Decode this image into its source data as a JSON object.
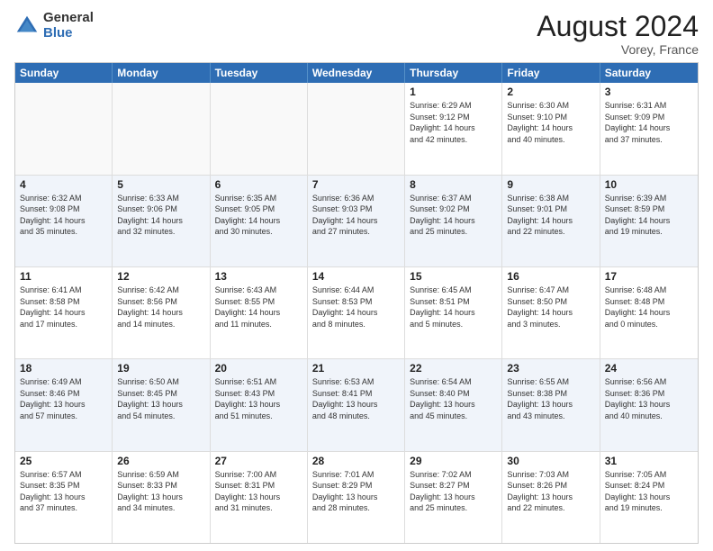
{
  "logo": {
    "general": "General",
    "blue": "Blue"
  },
  "header": {
    "month": "August 2024",
    "location": "Vorey, France"
  },
  "weekdays": [
    "Sunday",
    "Monday",
    "Tuesday",
    "Wednesday",
    "Thursday",
    "Friday",
    "Saturday"
  ],
  "rows": [
    [
      {
        "day": "",
        "info": "",
        "empty": true
      },
      {
        "day": "",
        "info": "",
        "empty": true
      },
      {
        "day": "",
        "info": "",
        "empty": true
      },
      {
        "day": "",
        "info": "",
        "empty": true
      },
      {
        "day": "1",
        "info": "Sunrise: 6:29 AM\nSunset: 9:12 PM\nDaylight: 14 hours\nand 42 minutes."
      },
      {
        "day": "2",
        "info": "Sunrise: 6:30 AM\nSunset: 9:10 PM\nDaylight: 14 hours\nand 40 minutes."
      },
      {
        "day": "3",
        "info": "Sunrise: 6:31 AM\nSunset: 9:09 PM\nDaylight: 14 hours\nand 37 minutes."
      }
    ],
    [
      {
        "day": "4",
        "info": "Sunrise: 6:32 AM\nSunset: 9:08 PM\nDaylight: 14 hours\nand 35 minutes."
      },
      {
        "day": "5",
        "info": "Sunrise: 6:33 AM\nSunset: 9:06 PM\nDaylight: 14 hours\nand 32 minutes."
      },
      {
        "day": "6",
        "info": "Sunrise: 6:35 AM\nSunset: 9:05 PM\nDaylight: 14 hours\nand 30 minutes."
      },
      {
        "day": "7",
        "info": "Sunrise: 6:36 AM\nSunset: 9:03 PM\nDaylight: 14 hours\nand 27 minutes."
      },
      {
        "day": "8",
        "info": "Sunrise: 6:37 AM\nSunset: 9:02 PM\nDaylight: 14 hours\nand 25 minutes."
      },
      {
        "day": "9",
        "info": "Sunrise: 6:38 AM\nSunset: 9:01 PM\nDaylight: 14 hours\nand 22 minutes."
      },
      {
        "day": "10",
        "info": "Sunrise: 6:39 AM\nSunset: 8:59 PM\nDaylight: 14 hours\nand 19 minutes."
      }
    ],
    [
      {
        "day": "11",
        "info": "Sunrise: 6:41 AM\nSunset: 8:58 PM\nDaylight: 14 hours\nand 17 minutes."
      },
      {
        "day": "12",
        "info": "Sunrise: 6:42 AM\nSunset: 8:56 PM\nDaylight: 14 hours\nand 14 minutes."
      },
      {
        "day": "13",
        "info": "Sunrise: 6:43 AM\nSunset: 8:55 PM\nDaylight: 14 hours\nand 11 minutes."
      },
      {
        "day": "14",
        "info": "Sunrise: 6:44 AM\nSunset: 8:53 PM\nDaylight: 14 hours\nand 8 minutes."
      },
      {
        "day": "15",
        "info": "Sunrise: 6:45 AM\nSunset: 8:51 PM\nDaylight: 14 hours\nand 5 minutes."
      },
      {
        "day": "16",
        "info": "Sunrise: 6:47 AM\nSunset: 8:50 PM\nDaylight: 14 hours\nand 3 minutes."
      },
      {
        "day": "17",
        "info": "Sunrise: 6:48 AM\nSunset: 8:48 PM\nDaylight: 14 hours\nand 0 minutes."
      }
    ],
    [
      {
        "day": "18",
        "info": "Sunrise: 6:49 AM\nSunset: 8:46 PM\nDaylight: 13 hours\nand 57 minutes."
      },
      {
        "day": "19",
        "info": "Sunrise: 6:50 AM\nSunset: 8:45 PM\nDaylight: 13 hours\nand 54 minutes."
      },
      {
        "day": "20",
        "info": "Sunrise: 6:51 AM\nSunset: 8:43 PM\nDaylight: 13 hours\nand 51 minutes."
      },
      {
        "day": "21",
        "info": "Sunrise: 6:53 AM\nSunset: 8:41 PM\nDaylight: 13 hours\nand 48 minutes."
      },
      {
        "day": "22",
        "info": "Sunrise: 6:54 AM\nSunset: 8:40 PM\nDaylight: 13 hours\nand 45 minutes."
      },
      {
        "day": "23",
        "info": "Sunrise: 6:55 AM\nSunset: 8:38 PM\nDaylight: 13 hours\nand 43 minutes."
      },
      {
        "day": "24",
        "info": "Sunrise: 6:56 AM\nSunset: 8:36 PM\nDaylight: 13 hours\nand 40 minutes."
      }
    ],
    [
      {
        "day": "25",
        "info": "Sunrise: 6:57 AM\nSunset: 8:35 PM\nDaylight: 13 hours\nand 37 minutes."
      },
      {
        "day": "26",
        "info": "Sunrise: 6:59 AM\nSunset: 8:33 PM\nDaylight: 13 hours\nand 34 minutes."
      },
      {
        "day": "27",
        "info": "Sunrise: 7:00 AM\nSunset: 8:31 PM\nDaylight: 13 hours\nand 31 minutes."
      },
      {
        "day": "28",
        "info": "Sunrise: 7:01 AM\nSunset: 8:29 PM\nDaylight: 13 hours\nand 28 minutes."
      },
      {
        "day": "29",
        "info": "Sunrise: 7:02 AM\nSunset: 8:27 PM\nDaylight: 13 hours\nand 25 minutes."
      },
      {
        "day": "30",
        "info": "Sunrise: 7:03 AM\nSunset: 8:26 PM\nDaylight: 13 hours\nand 22 minutes."
      },
      {
        "day": "31",
        "info": "Sunrise: 7:05 AM\nSunset: 8:24 PM\nDaylight: 13 hours\nand 19 minutes."
      }
    ]
  ]
}
